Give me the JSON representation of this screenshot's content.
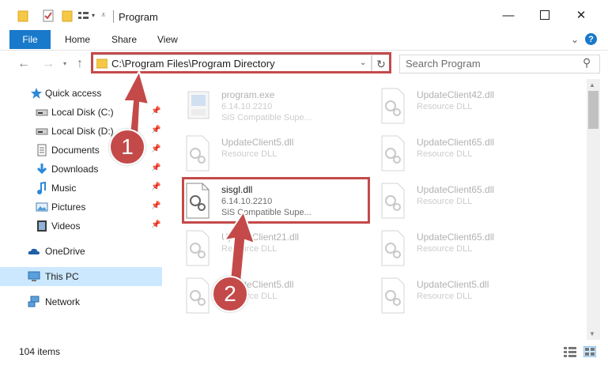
{
  "window": {
    "title": "Program",
    "minimize_icon": "minimize-icon",
    "maximize_icon": "maximize-icon",
    "close_icon": "close-icon"
  },
  "ribbon": {
    "tabs": [
      "File",
      "Home",
      "Share",
      "View"
    ]
  },
  "nav": {
    "address": "C:\\Program Files\\Program Directory",
    "search_placeholder": "Search Program"
  },
  "sidebar": {
    "items": [
      {
        "label": "Quick access",
        "icon": "star-icon",
        "pinned": false
      },
      {
        "label": "Local Disk (C:)",
        "icon": "drive-icon",
        "pinned": true
      },
      {
        "label": "Local Disk (D:)",
        "icon": "drive-icon",
        "pinned": true
      },
      {
        "label": "Documents",
        "icon": "documents-icon",
        "pinned": true
      },
      {
        "label": "Downloads",
        "icon": "downloads-icon",
        "pinned": true
      },
      {
        "label": "Music",
        "icon": "music-icon",
        "pinned": true
      },
      {
        "label": "Pictures",
        "icon": "pictures-icon",
        "pinned": true
      },
      {
        "label": "Videos",
        "icon": "videos-icon",
        "pinned": true
      },
      {
        "label": "OneDrive",
        "icon": "cloud-icon",
        "pinned": false
      },
      {
        "label": "This PC",
        "icon": "computer-icon",
        "pinned": false,
        "selected": true
      },
      {
        "label": "Network",
        "icon": "network-icon",
        "pinned": false
      }
    ]
  },
  "files": {
    "left": [
      {
        "name": "program.exe",
        "line1": "6.14.10.2210",
        "line2": "SiS Compatible Supe...",
        "faded": true
      },
      {
        "name": "UpdateClient5.dll",
        "line1": "Resource DLL",
        "line2": "",
        "faded": true
      },
      {
        "name": "sisgl.dll",
        "line1": "6.14.10.2210",
        "line2": "SiS Compatible Supe...",
        "faded": false
      },
      {
        "name": "UpdateClient21.dll",
        "line1": "Resource DLL",
        "line2": "",
        "faded": true
      },
      {
        "name": "UpdateClient5.dll",
        "line1": "Resource DLL",
        "line2": "",
        "faded": true
      }
    ],
    "right": [
      {
        "name": "UpdateClient42.dll",
        "line1": "Resource DLL",
        "line2": "",
        "faded": true
      },
      {
        "name": "UpdateClient65.dll",
        "line1": "Resource DLL",
        "line2": "",
        "faded": true
      },
      {
        "name": "UpdateClient65.dll",
        "line1": "Resource DLL",
        "line2": "",
        "faded": true
      },
      {
        "name": "UpdateClient65.dll",
        "line1": "Resource DLL",
        "line2": "",
        "faded": true
      },
      {
        "name": "UpdateClient5.dll",
        "line1": "Resource DLL",
        "line2": "",
        "faded": true
      }
    ]
  },
  "status": {
    "item_count": "104 items"
  },
  "annotations": {
    "step1": "1",
    "step2": "2",
    "color": "#c44a4a"
  }
}
